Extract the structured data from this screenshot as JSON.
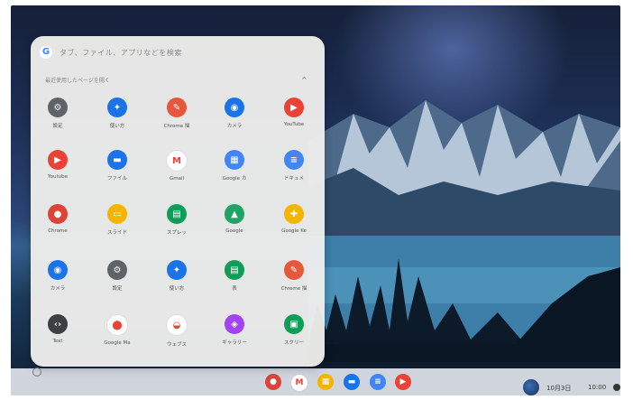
{
  "launcher": {
    "search_placeholder": "タブ、ファイル、アプリなどを検索",
    "recent_section_label": "最近使用したページを開く",
    "apps": [
      {
        "label": "設定",
        "icon": "gear-icon",
        "glyph": "⚙",
        "color": "#5f6368"
      },
      {
        "label": "使い方",
        "icon": "tips-icon",
        "glyph": "✦",
        "color": "#1a73e8"
      },
      {
        "label": "Chrome 描",
        "icon": "palette-icon",
        "glyph": "✎",
        "color": "#e8573c"
      },
      {
        "label": "カメラ",
        "icon": "camera-icon",
        "glyph": "◉",
        "color": "#1a73e8"
      },
      {
        "label": "YouTube",
        "icon": "youtube-icon",
        "glyph": "▶",
        "color": "#ea4335"
      },
      {
        "label": "Youtube",
        "icon": "youtube-icon",
        "glyph": "▶",
        "color": "#ea4335"
      },
      {
        "label": "ファイル",
        "icon": "folder-icon",
        "glyph": "▬",
        "color": "#1a73e8"
      },
      {
        "label": "Gmail",
        "icon": "gmail-icon",
        "glyph": "M",
        "color": "#ffffff"
      },
      {
        "label": "Google カ",
        "icon": "calendar-icon",
        "glyph": "▦",
        "color": "#4285f4"
      },
      {
        "label": "ドキュメ",
        "icon": "docs-icon",
        "glyph": "≡",
        "color": "#4285f4"
      },
      {
        "label": "Chrome",
        "icon": "chrome-icon",
        "glyph": "●",
        "color": "#db4437"
      },
      {
        "label": "スライド",
        "icon": "slides-icon",
        "glyph": "▭",
        "color": "#f4b400"
      },
      {
        "label": "スプレッ",
        "icon": "sheets-icon",
        "glyph": "▤",
        "color": "#0f9d58"
      },
      {
        "label": "Google",
        "icon": "drive-icon",
        "glyph": "▲",
        "color": "#1fa463"
      },
      {
        "label": "Google Ke",
        "icon": "keep-icon",
        "glyph": "✚",
        "color": "#f4b400"
      },
      {
        "label": "カメラ",
        "icon": "camera-icon",
        "glyph": "◉",
        "color": "#1a73e8"
      },
      {
        "label": "設定",
        "icon": "gear-icon",
        "glyph": "⚙",
        "color": "#5f6368"
      },
      {
        "label": "使い方",
        "icon": "tips-icon",
        "glyph": "✦",
        "color": "#1a73e8"
      },
      {
        "label": "表",
        "icon": "sheets-icon",
        "glyph": "▤",
        "color": "#0f9d58"
      },
      {
        "label": "Chrome 描",
        "icon": "palette-icon",
        "glyph": "✎",
        "color": "#e8573c"
      },
      {
        "label": "Text",
        "icon": "text-icon",
        "glyph": "‹›",
        "color": "#3c4043"
      },
      {
        "label": "Google Ma",
        "icon": "maps-icon",
        "glyph": "⬤",
        "color": "#ffffff"
      },
      {
        "label": "ウェブス",
        "icon": "webstore-icon",
        "glyph": "◒",
        "color": "#ffffff"
      },
      {
        "label": "ギャラリー",
        "icon": "gallery-icon",
        "glyph": "◈",
        "color": "#a142f4"
      },
      {
        "label": "スクリー",
        "icon": "screencast-icon",
        "glyph": "▣",
        "color": "#0f9d58"
      }
    ]
  },
  "shelf": {
    "apps": [
      {
        "icon": "chrome-icon",
        "glyph": "●",
        "color": "#db4437"
      },
      {
        "icon": "gmail-icon",
        "glyph": "M",
        "color": "#ffffff"
      },
      {
        "icon": "calendar-icon",
        "glyph": "▦",
        "color": "#f4b400"
      },
      {
        "icon": "folder-icon",
        "glyph": "▬",
        "color": "#1a73e8"
      },
      {
        "icon": "docs-icon",
        "glyph": "≡",
        "color": "#4285f4"
      },
      {
        "icon": "youtube-icon",
        "glyph": "▶",
        "color": "#ea4335"
      }
    ],
    "date": "10月3日",
    "time": "10:00"
  }
}
